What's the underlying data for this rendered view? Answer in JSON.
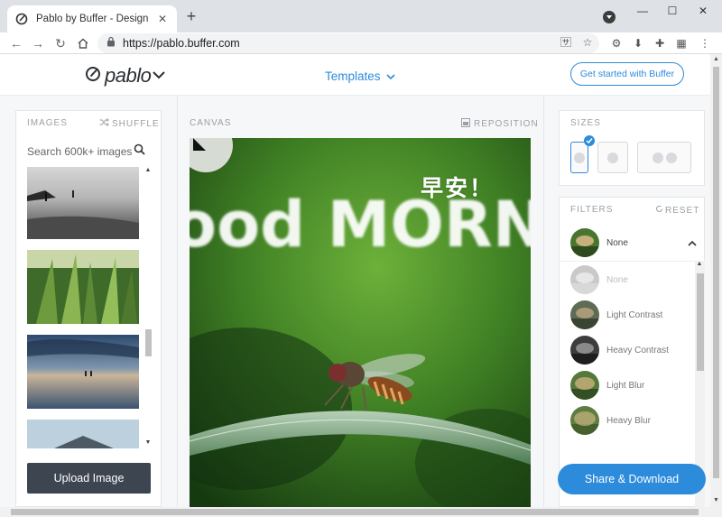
{
  "browser": {
    "tab_title": "Pablo by Buffer - Design engag",
    "url": "https://pablo.buffer.com",
    "new_tab_label": "+",
    "close_tab_label": "✕"
  },
  "header": {
    "logo_text": "pablo",
    "templates_label": "Templates",
    "get_started_label": "Get started with Buffer"
  },
  "images_panel": {
    "title": "IMAGES",
    "shuffle_label": "SHUFFLE",
    "search_placeholder": "Search 600k+ images",
    "upload_label": "Upload Image"
  },
  "canvas": {
    "title": "CANVAS",
    "reposition_label": "REPOSITION",
    "overlay_text": "早安！",
    "background_text": "ood MORNIN"
  },
  "sizes_panel": {
    "title": "SIZES"
  },
  "filters_panel": {
    "title": "FILTERS",
    "reset_label": "RESET",
    "current": "None",
    "options": [
      "None",
      "Light Contrast",
      "Heavy Contrast",
      "Light Blur",
      "Heavy Blur"
    ]
  },
  "share_label": "Share & Download",
  "colors": {
    "accent": "#2d8bdc",
    "upload_button": "#3d4550"
  }
}
